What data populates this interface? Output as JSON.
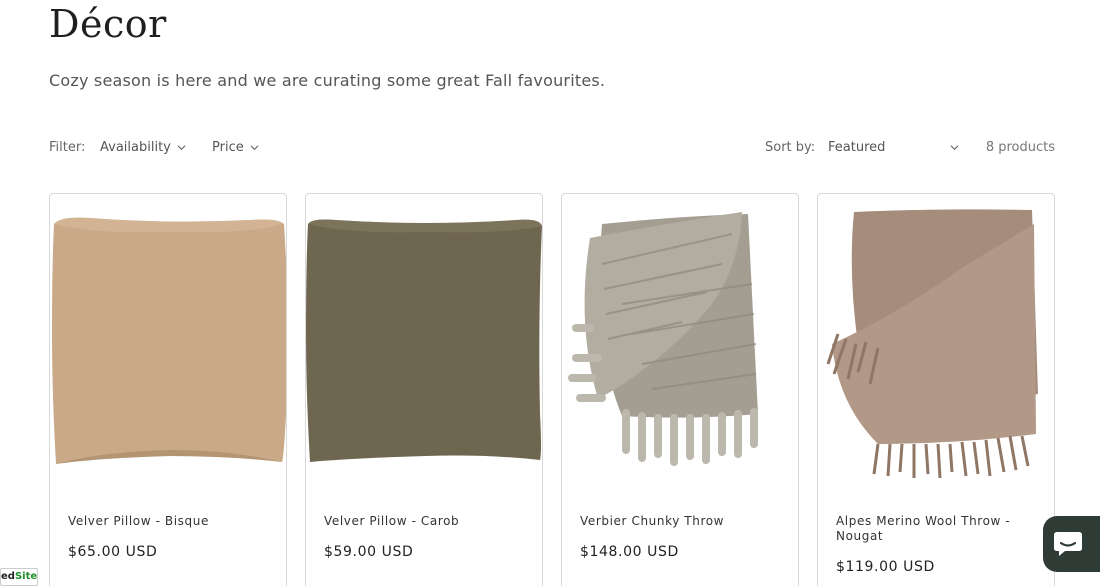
{
  "collection": {
    "title": "Décor",
    "description": "Cozy season is here and we are curating some great Fall favourites."
  },
  "filters": {
    "label": "Filter:",
    "availability": "Availability",
    "price": "Price"
  },
  "sort": {
    "label": "Sort by:",
    "selected": "Featured"
  },
  "count": "8 products",
  "products": [
    {
      "name": "Velver Pillow - Bisque",
      "price": "$65.00 USD"
    },
    {
      "name": "Velver Pillow - Carob",
      "price": "$59.00 USD"
    },
    {
      "name": "Verbier Chunky Throw",
      "price": "$148.00 USD"
    },
    {
      "name": "Alpes Merino Wool Throw - Nougat",
      "price": "$119.00 USD"
    }
  ],
  "badge": {
    "prefix": "ed",
    "suffix": "Site"
  },
  "colors": {
    "bisque": "#c9a987",
    "carob": "#6f6650",
    "throw_grey": "#a8a296",
    "nougat": "#a58c7b"
  }
}
